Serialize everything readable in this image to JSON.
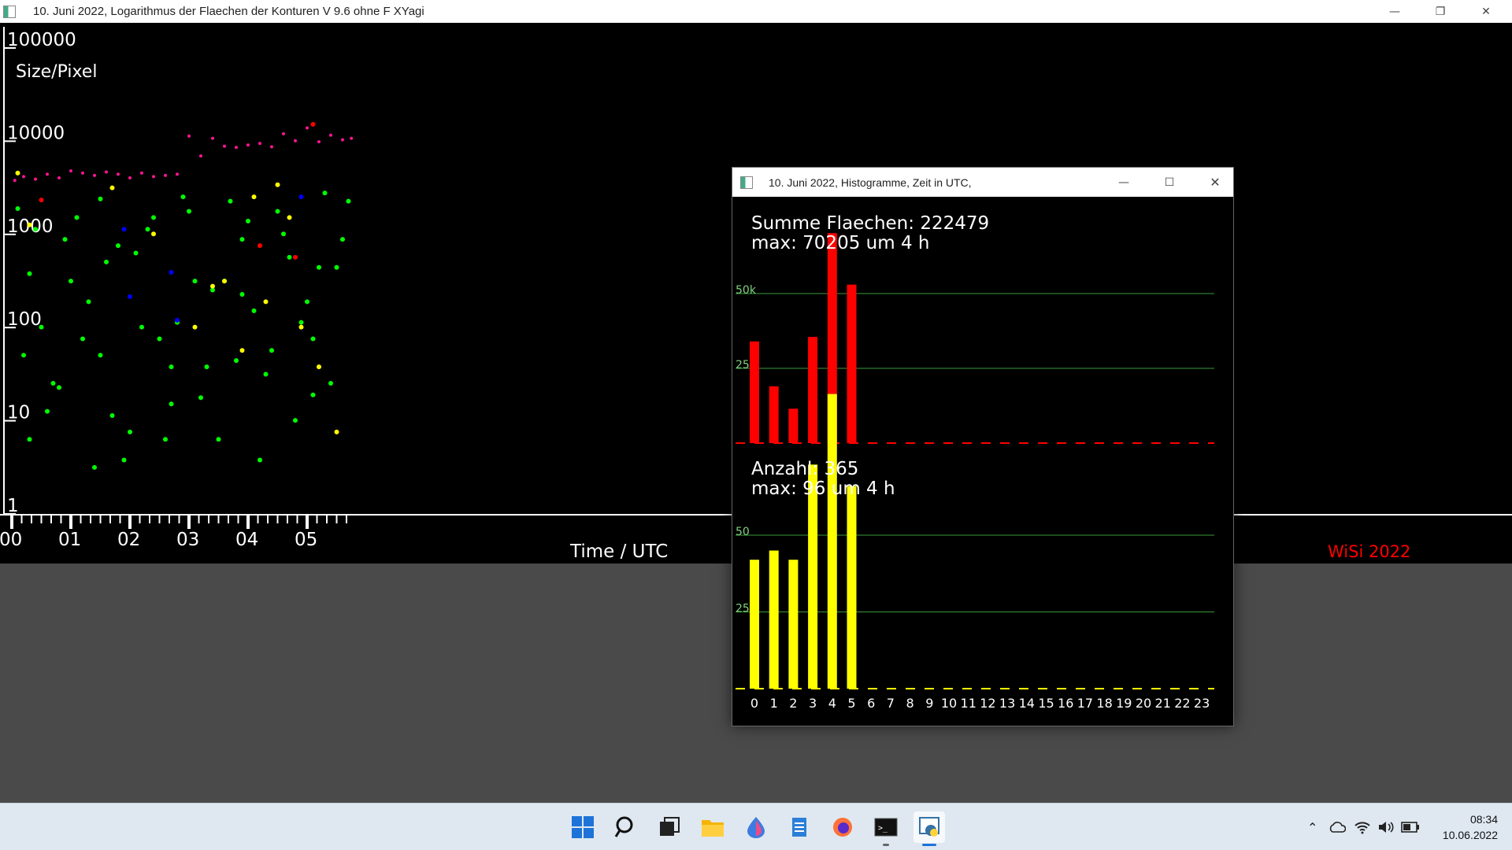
{
  "main_window": {
    "title": "10. Juni 2022, Logarithmus der Flaechen der Konturen  V 9.6 ohne F XYagi",
    "y_axis_label": "Size/Pixel",
    "x_axis_label": "Time / UTC",
    "watermark": "WiSi 2022",
    "y_ticks": [
      "100000",
      "10000",
      "1000",
      "100",
      "10",
      "1"
    ],
    "x_ticks": [
      "00",
      "01",
      "02",
      "03",
      "04",
      "05"
    ]
  },
  "hist_window": {
    "title": "10. Juni 2022, Histogramme, Zeit in UTC,",
    "area_sum_label": "Summe Flaechen: 222479",
    "area_max_label": "max: 70205 um 4 h",
    "count_label": "Anzahl: 365",
    "count_max_label": "max: 96 um 4 h",
    "area_ticks": [
      "50k",
      "25k"
    ],
    "count_ticks": [
      "50",
      "25"
    ],
    "hour_labels": [
      "0",
      "1",
      "2",
      "3",
      "4",
      "5",
      "6",
      "7",
      "8",
      "9",
      "10",
      "11",
      "12",
      "13",
      "14",
      "15",
      "16",
      "17",
      "18",
      "19",
      "20",
      "21",
      "22",
      "23"
    ]
  },
  "chart_data": [
    {
      "type": "bar",
      "categories": [
        "0",
        "1",
        "2",
        "3",
        "4",
        "5",
        "6",
        "7",
        "8",
        "9",
        "10",
        "11",
        "12",
        "13",
        "14",
        "15",
        "16",
        "17",
        "18",
        "19",
        "20",
        "21",
        "22",
        "23"
      ],
      "values": [
        34000,
        19000,
        11500,
        35500,
        70205,
        53000,
        0,
        0,
        0,
        0,
        0,
        0,
        0,
        0,
        0,
        0,
        0,
        0,
        0,
        0,
        0,
        0,
        0,
        0
      ],
      "ylim": [
        0,
        50000
      ],
      "grid": true,
      "colors": {
        "bar": "#ff0000",
        "grid": "#3a9a3a"
      }
    },
    {
      "type": "bar",
      "categories": [
        "0",
        "1",
        "2",
        "3",
        "4",
        "5",
        "6",
        "7",
        "8",
        "9",
        "10",
        "11",
        "12",
        "13",
        "14",
        "15",
        "16",
        "17",
        "18",
        "19",
        "20",
        "21",
        "22",
        "23"
      ],
      "values": [
        42,
        45,
        42,
        73,
        96,
        66,
        0,
        0,
        0,
        0,
        0,
        0,
        0,
        0,
        0,
        0,
        0,
        0,
        0,
        0,
        0,
        0,
        0,
        0
      ],
      "ylim": [
        0,
        50
      ],
      "grid": true,
      "colors": {
        "bar": "#ffff00",
        "grid": "#3a9a3a"
      }
    },
    {
      "type": "scatter",
      "x_unit": "h UTC",
      "y_scale": "log",
      "ylim": [
        1,
        100000
      ],
      "xlim": [
        0,
        5.8
      ],
      "colors": {
        "large": "#ff1493",
        "main": "#00ff00",
        "alt1": "#ffff00",
        "alt2": "#0000ff",
        "alt3": "#ff0000"
      },
      "series": [
        {
          "color": "#ff1493",
          "x": [
            0.05,
            0.2,
            0.4,
            0.6,
            0.8,
            1.0,
            1.2,
            1.4,
            1.6,
            1.8,
            2.0,
            2.2,
            2.4,
            2.6,
            2.8,
            3.0,
            3.2,
            3.4,
            3.6,
            3.8,
            4.0,
            4.2,
            4.4,
            4.6,
            4.8,
            5.0,
            5.2,
            5.4,
            5.6,
            5.75
          ],
          "y": [
            3000,
            3300,
            3100,
            3500,
            3200,
            3800,
            3600,
            3400,
            3700,
            3500,
            3200,
            3600,
            3300,
            3400,
            3500,
            9000,
            5500,
            8500,
            7000,
            6800,
            7200,
            7500,
            6900,
            9500,
            8000,
            11000,
            7800,
            9200,
            8200,
            8500
          ]
        },
        {
          "color": "#00ff00",
          "x": [
            0.1,
            0.3,
            0.5,
            0.7,
            0.9,
            1.1,
            1.3,
            1.5,
            1.7,
            1.9,
            2.1,
            2.3,
            2.5,
            2.7,
            2.9,
            3.1,
            3.3,
            3.5,
            3.7,
            3.9,
            4.1,
            4.3,
            4.5,
            4.7,
            4.9,
            5.1,
            5.3,
            5.5,
            5.7,
            0.2,
            0.6,
            1.0,
            1.4,
            1.8,
            2.2,
            2.6,
            3.0,
            3.4,
            3.8,
            4.2,
            4.6,
            5.0,
            5.4,
            0.4,
            0.8,
            1.2,
            1.6,
            2.0,
            2.4,
            2.8,
            3.2,
            3.6,
            4.0,
            4.4,
            4.8,
            5.2,
            5.6,
            0.3,
            1.5,
            2.7,
            3.9,
            5.1
          ],
          "y": [
            1500,
            300,
            80,
            20,
            700,
            1200,
            150,
            40,
            9,
            3,
            500,
            900,
            60,
            12,
            2000,
            250,
            30,
            5,
            1800,
            700,
            120,
            25,
            1400,
            450,
            90,
            15,
            2200,
            350,
            1800,
            40,
            10,
            250,
            2.5,
            600,
            80,
            5,
            1400,
            200,
            35,
            3,
            800,
            150,
            20,
            900,
            18,
            60,
            400,
            6,
            1200,
            90,
            14,
            250,
            1100,
            45,
            8,
            350,
            700,
            5,
            1900,
            30,
            180,
            60
          ]
        },
        {
          "color": "#ffff00",
          "x": [
            0.1,
            0.3,
            1.7,
            2.4,
            3.1,
            3.4,
            3.6,
            3.9,
            4.1,
            4.3,
            4.5,
            4.7,
            4.9,
            5.2,
            5.5
          ],
          "y": [
            3600,
            1000,
            2500,
            800,
            80,
            220,
            250,
            45,
            2000,
            150,
            2700,
            1200,
            80,
            30,
            6
          ]
        },
        {
          "color": "#0000ff",
          "x": [
            1.9,
            2.0,
            2.7,
            2.8,
            4.9
          ],
          "y": [
            900,
            170,
            310,
            95,
            2000
          ]
        },
        {
          "color": "#ff0000",
          "x": [
            0.5,
            4.2,
            4.8,
            5.1
          ],
          "y": [
            1850,
            600,
            450,
            12000
          ]
        }
      ]
    }
  ]
}
